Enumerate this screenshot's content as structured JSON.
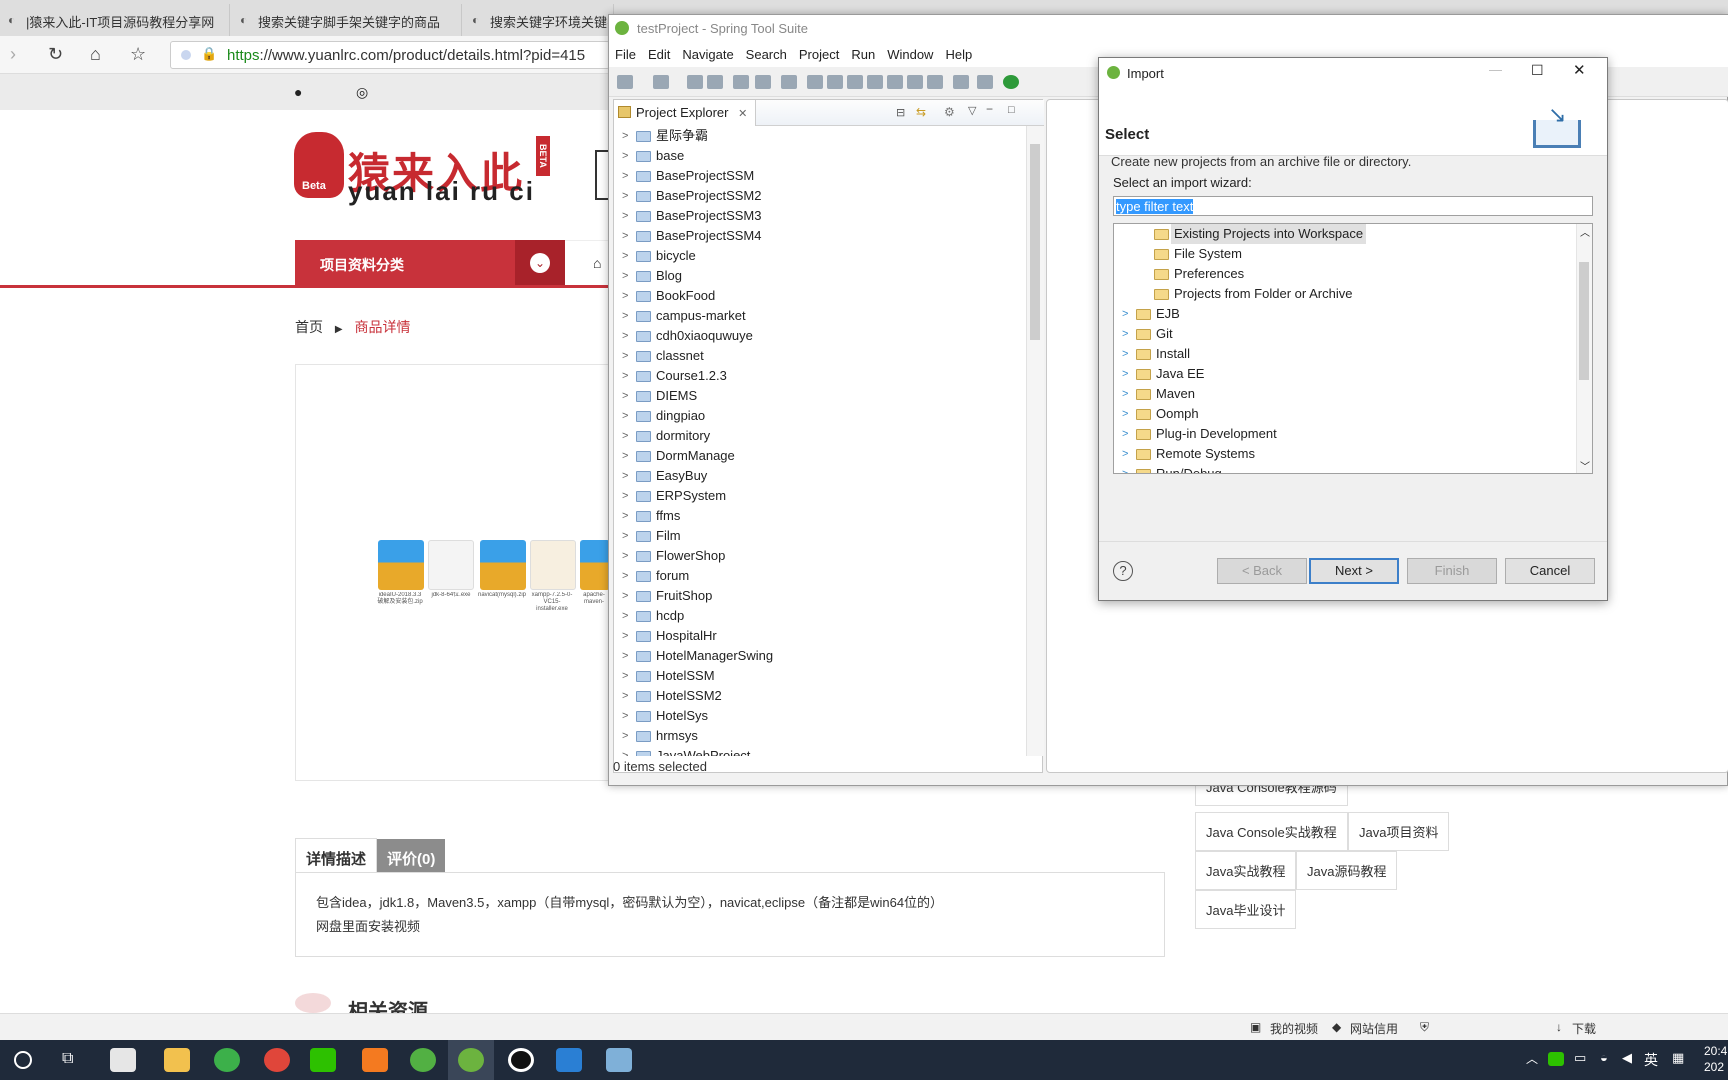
{
  "browser": {
    "tabs": [
      "|猿来入此-IT项目源码教程分享网",
      "搜索关键字脚手架关键字的商品",
      "搜索关键字环境关键字"
    ],
    "url_prefix": "https",
    "url_rest": "://www.yuanlrc.com/product/details.html?pid=415"
  },
  "web": {
    "logo_cn": "猿来入此",
    "logo_en": "yuan lai ru ci",
    "logo_badge": "Beta",
    "logo_side_badge": "BETA",
    "category_btn": "项目资料分类",
    "breadcrumb_home": "首页",
    "breadcrumb_current": "商品详情",
    "files": [
      "ideaIU-2018.3.3破解及安装包.zip",
      "jdk-8-64位.exe",
      "navicat(mysql).zip",
      "xampp-7.2.5-0-VC15-installer.exe",
      "apache-maven-3.5.0.zip"
    ],
    "tabs": [
      "详情描述",
      "评价(0)"
    ],
    "desc_line1": "包含idea，jdk1.8，Maven3.5，xampp（自带mysql，密码默认为空），navicat,eclipse（备注都是win64位的）",
    "desc_line2": "网盘里面安装视频",
    "related": "相关资源",
    "tags": [
      "Java Console教程源码",
      "Java Console实战教程",
      "Java项目资料",
      "Java实战教程",
      "Java源码教程",
      "Java毕业设计"
    ],
    "status_items": [
      "我的视频",
      "网站信用",
      "下载"
    ]
  },
  "sts": {
    "title": "testProject - Spring Tool Suite",
    "menu": [
      "File",
      "Edit",
      "Navigate",
      "Search",
      "Project",
      "Run",
      "Window",
      "Help"
    ],
    "explorer_title": "Project Explorer",
    "projects": [
      "星际争霸",
      "base",
      "BaseProjectSSM",
      "BaseProjectSSM2",
      "BaseProjectSSM3",
      "BaseProjectSSM4",
      "bicycle",
      "Blog",
      "BookFood",
      "campus-market",
      "cdh0xiaoquwuye",
      "classnet",
      "Course1.2.3",
      "DIEMS",
      "dingpiao",
      "dormitory",
      "DormManage",
      "EasyBuy",
      "ERPSystem",
      "ffms",
      "Film",
      "FlowerShop",
      "forum",
      "FruitShop",
      "hcdp",
      "HospitalHr",
      "HotelManagerSwing",
      "HotelSSM",
      "HotelSSM2",
      "HotelSys",
      "hrmsys",
      "JavaWebProject"
    ],
    "status": "0 items selected"
  },
  "import": {
    "title": "Import",
    "heading": "Select",
    "description": "Create new projects from an archive file or directory.",
    "wizard_label": "Select an import wizard:",
    "filter_value": "type filter text",
    "general_items": [
      "Existing Projects into Workspace",
      "File System",
      "Preferences",
      "Projects from Folder or Archive"
    ],
    "categories": [
      "EJB",
      "Git",
      "Install",
      "Java EE",
      "Maven",
      "Oomph",
      "Plug-in Development",
      "Remote Systems",
      "Run/Debug"
    ],
    "buttons": {
      "back": "< Back",
      "next": "Next >",
      "finish": "Finish",
      "cancel": "Cancel"
    },
    "help": "?"
  },
  "taskbar": {
    "ime": "英",
    "clock": "20:4",
    "date": "202"
  },
  "colors": {
    "brand_red": "#c8323b",
    "selection": "#3399ff",
    "taskbar": "#1f2a3a"
  }
}
